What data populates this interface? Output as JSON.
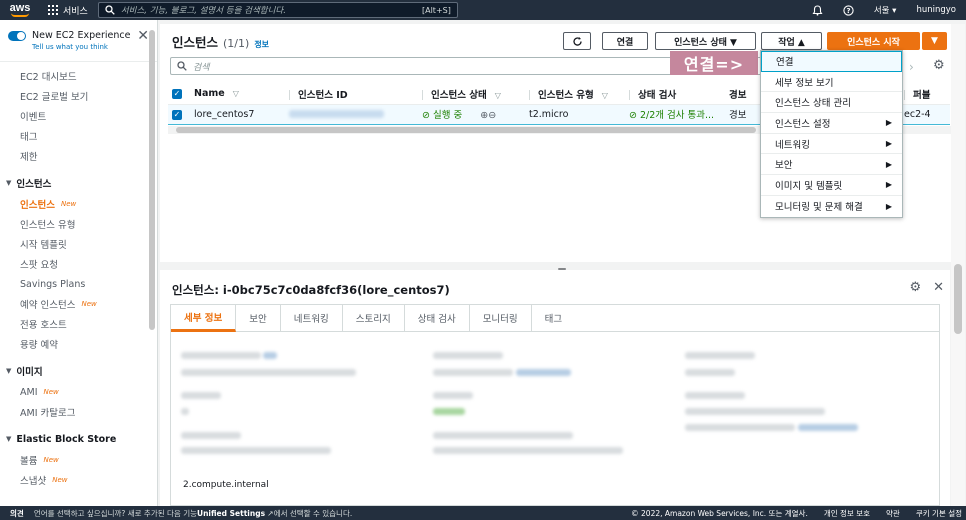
{
  "topnav": {
    "logo": "aws",
    "services_label": "서비스",
    "search_placeholder": "서비스, 기능, 블로그, 설명서 등을 검색합니다.",
    "search_shortcut": "[Alt+S]",
    "region": "서울 ▾",
    "user": "huningyo",
    "bell_icon": "bell-icon",
    "help_icon": "help-icon"
  },
  "sidebar": {
    "experience_title": "New EC2 Experience",
    "experience_sub": "Tell us what you think",
    "top_items": [
      "EC2 대시보드",
      "EC2 글로벌 보기",
      "이벤트",
      "태그",
      "제한"
    ],
    "section_instances": "인스턴스",
    "instances_items": [
      {
        "label": "인스턴스",
        "new": "New",
        "active": true
      },
      {
        "label": "인스턴스 유형",
        "new": "",
        "active": false
      },
      {
        "label": "시작 템플릿",
        "new": "",
        "active": false
      },
      {
        "label": "스팟 요청",
        "new": "",
        "active": false
      },
      {
        "label": "Savings Plans",
        "new": "",
        "active": false
      },
      {
        "label": "예약 인스턴스",
        "new": "New",
        "active": false
      },
      {
        "label": "전용 호스트",
        "new": "",
        "active": false
      },
      {
        "label": "용량 예약",
        "new": "",
        "active": false
      }
    ],
    "section_images": "이미지",
    "images_items": [
      {
        "label": "AMI",
        "new": "New"
      },
      {
        "label": "AMI 카탈로그",
        "new": ""
      }
    ],
    "section_ebs": "Elastic Block Store",
    "ebs_items": [
      {
        "label": "볼륨",
        "new": "New"
      },
      {
        "label": "스냅샷",
        "new": "New"
      }
    ]
  },
  "instances_panel": {
    "title": "인스턴스",
    "count": "(1/1)",
    "info": "정보",
    "refresh_icon": "refresh-icon",
    "connect_btn": "연결",
    "state_btn": "인스턴스 상태 ▼",
    "actions_btn": "작업 ▲",
    "launch_btn": "인스턴스 시작",
    "launch_dropdown": "▼",
    "filter_placeholder": "검색",
    "columns": [
      "Name",
      "인스턴스 ID",
      "인스턴스 상태",
      "인스턴스 유형",
      "상태 검사",
      "경보",
      "퍼블"
    ],
    "row": {
      "name": "lore_centos7",
      "state": "⊘ 실행 중",
      "zoom": "⊕⊖",
      "type": "t2.micro",
      "check": "⊘ 2/2개 검사 통과...",
      "alarm": "경보",
      "public": "ec2-4"
    }
  },
  "actions_menu": {
    "items": [
      {
        "label": "연결",
        "sub": false,
        "highlight": true
      },
      {
        "label": "세부 정보 보기",
        "sub": false,
        "highlight": false
      },
      {
        "label": "인스턴스 상태 관리",
        "sub": false,
        "highlight": false
      },
      {
        "label": "인스턴스 설정",
        "sub": true,
        "highlight": false
      },
      {
        "label": "네트워킹",
        "sub": true,
        "highlight": false
      },
      {
        "label": "보안",
        "sub": true,
        "highlight": false
      },
      {
        "label": "이미지 및 템플릿",
        "sub": true,
        "highlight": false
      },
      {
        "label": "모니터링 및 문제 해결",
        "sub": true,
        "highlight": false
      }
    ]
  },
  "annotation": "연결=>",
  "detail": {
    "handle": "=",
    "title": "인스턴스: i-0bc75c7c0da8fcf36(lore_centos7)",
    "tabs": [
      "세부 정보",
      "보안",
      "네트워킹",
      "스토리지",
      "상태 검사",
      "모니터링",
      "태그"
    ],
    "active_tab": "세부 정보",
    "visible_value": "2.compute.internal"
  },
  "footer": {
    "feedback": "의견",
    "message_pre": "언어를 선택하고 싶으십니까? 새로 추가된 다음 기능",
    "message_bold": "Unified Settings",
    "message_post": "에서 선택할 수 있습니다.",
    "copyright": "© 2022, Amazon Web Services, Inc. 또는 계열사.",
    "privacy": "개인 정보 보호",
    "terms": "약관",
    "cookies": "쿠키 기본 설정"
  },
  "colors": {
    "nav_bg": "#232f3e",
    "accent": "#ec7211",
    "link": "#0073bb",
    "success": "#1d8102",
    "annotation_bg": "#c5879d"
  }
}
